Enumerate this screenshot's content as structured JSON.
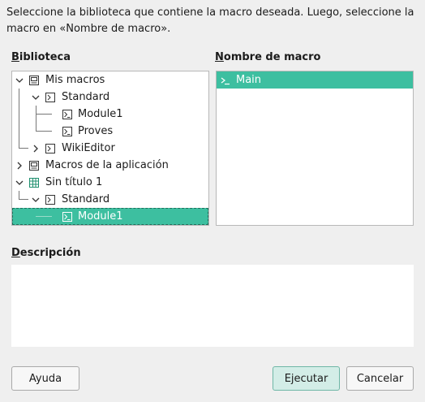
{
  "instructions": "Seleccione la biblioteca que contiene la macro deseada. Luego, seleccione la macro en «Nombre de macro».",
  "labels": {
    "library_first": "B",
    "library_rest": "iblioteca",
    "macro_name_first": "N",
    "macro_name_rest": "ombre de macro",
    "description_first": "D",
    "description_rest": "escripción"
  },
  "tree": [
    {
      "label": "Mis macros",
      "icon": "macro-container-icon",
      "expanded": true
    },
    {
      "label": "Standard",
      "icon": "library-icon",
      "expanded": true
    },
    {
      "label": "Module1",
      "icon": "module-icon"
    },
    {
      "label": "Proves",
      "icon": "module-icon"
    },
    {
      "label": "WikiEditor",
      "icon": "library-icon",
      "expanded": false
    },
    {
      "label": "Macros de la aplicación",
      "icon": "macro-container-icon",
      "expanded": false
    },
    {
      "label": "Sin título 1",
      "icon": "spreadsheet-document-icon",
      "expanded": true
    },
    {
      "label": "Standard",
      "icon": "library-icon",
      "expanded": true
    },
    {
      "label": "Module1",
      "icon": "module-icon",
      "selected": true
    }
  ],
  "macros": [
    {
      "label": "Main",
      "selected": true
    }
  ],
  "buttons": {
    "help": "Ayuda",
    "run": "Ejecutar",
    "cancel": "Cancelar"
  },
  "colors": {
    "selection": "#3dbfa0",
    "primary_button": "#d3ede7"
  }
}
